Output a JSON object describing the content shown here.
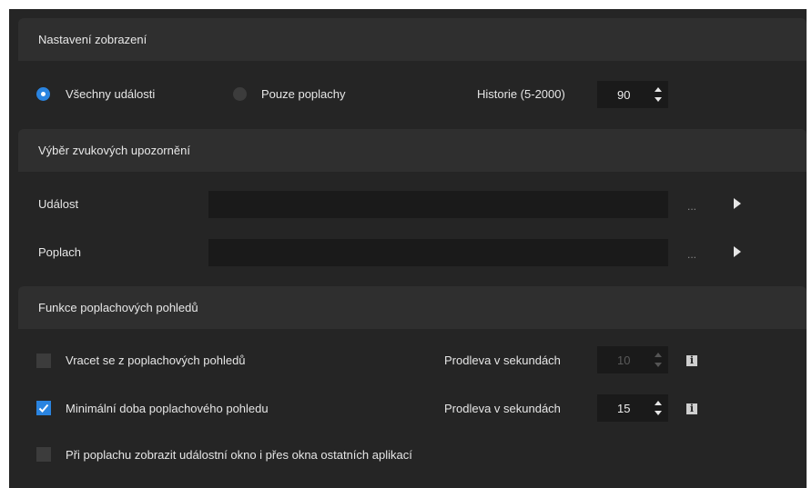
{
  "display_settings": {
    "header": "Nastavení zobrazení",
    "radio_all_events": {
      "label": "Všechny události",
      "checked": true
    },
    "radio_alarms_only": {
      "label": "Pouze poplachy",
      "checked": false
    },
    "history_label": "Historie (5-2000)",
    "history_value": "90"
  },
  "sound_notifications": {
    "header": "Výběr zvukových upozornění",
    "event_label": "Událost",
    "event_value": "",
    "alarm_label": "Poplach",
    "alarm_value": "",
    "browse_label": "...",
    "play_icon": "play-icon"
  },
  "alarm_views": {
    "header": "Funkce poplachových pohledů",
    "return_views": {
      "label": "Vracet se z poplachových pohledů",
      "checked": false
    },
    "return_delay_label": "Prodleva v sekundách",
    "return_delay_value": "10",
    "min_duration": {
      "label": "Minimální doba poplachového pohledu",
      "checked": true
    },
    "min_delay_label": "Prodleva v sekundách",
    "min_delay_value": "15",
    "show_on_top": {
      "label": "Při poplachu zobrazit událostní okno i přes okna ostatních aplikací",
      "checked": false
    },
    "info_icon": "info-icon"
  },
  "colors": {
    "background": "#252525",
    "header": "#2f2f2f",
    "field": "#1a1a1a",
    "accent": "#2a84e0"
  }
}
